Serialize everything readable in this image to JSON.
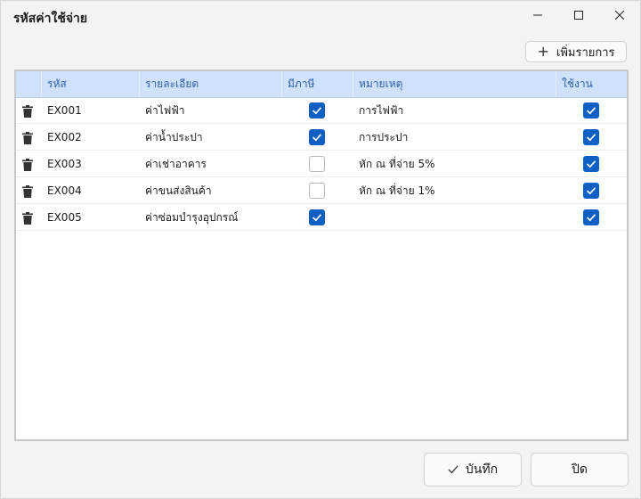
{
  "window": {
    "title": "รหัสค่าใช้จ่าย",
    "controls": {
      "minimize": "─",
      "maximize": "☐",
      "close": "✕"
    }
  },
  "toolbar": {
    "add_label": "เพิ่มรายการ",
    "add_icon": "plus-icon"
  },
  "table": {
    "columns": [
      "รหัส",
      "รายละเอียด",
      "มีภาษี",
      "หมายเหตุ",
      "ใช้งาน"
    ],
    "rows": [
      {
        "code": "EX001",
        "detail": "ค่าไฟฟ้า",
        "taxable": true,
        "note": "การไฟฟ้า",
        "active": true
      },
      {
        "code": "EX002",
        "detail": "ค่าน้ำประปา",
        "taxable": true,
        "note": "การประปา",
        "active": true
      },
      {
        "code": "EX003",
        "detail": "ค่าเช่าอาคาร",
        "taxable": false,
        "note": "หัก ณ ที่จ่าย 5%",
        "active": true
      },
      {
        "code": "EX004",
        "detail": "ค่าขนส่งสินค้า",
        "taxable": false,
        "note": "หัก ณ ที่จ่าย 1%",
        "active": true
      },
      {
        "code": "EX005",
        "detail": "ค่าซ่อมบำรุงอุปกรณ์",
        "taxable": true,
        "note": "",
        "active": true
      }
    ]
  },
  "footer": {
    "save_label": "บันทึก",
    "close_label": "ปิด"
  },
  "colors": {
    "accent": "#0f5fc4",
    "header_bg": "#cfe1fb",
    "header_text": "#2f5fa8"
  }
}
